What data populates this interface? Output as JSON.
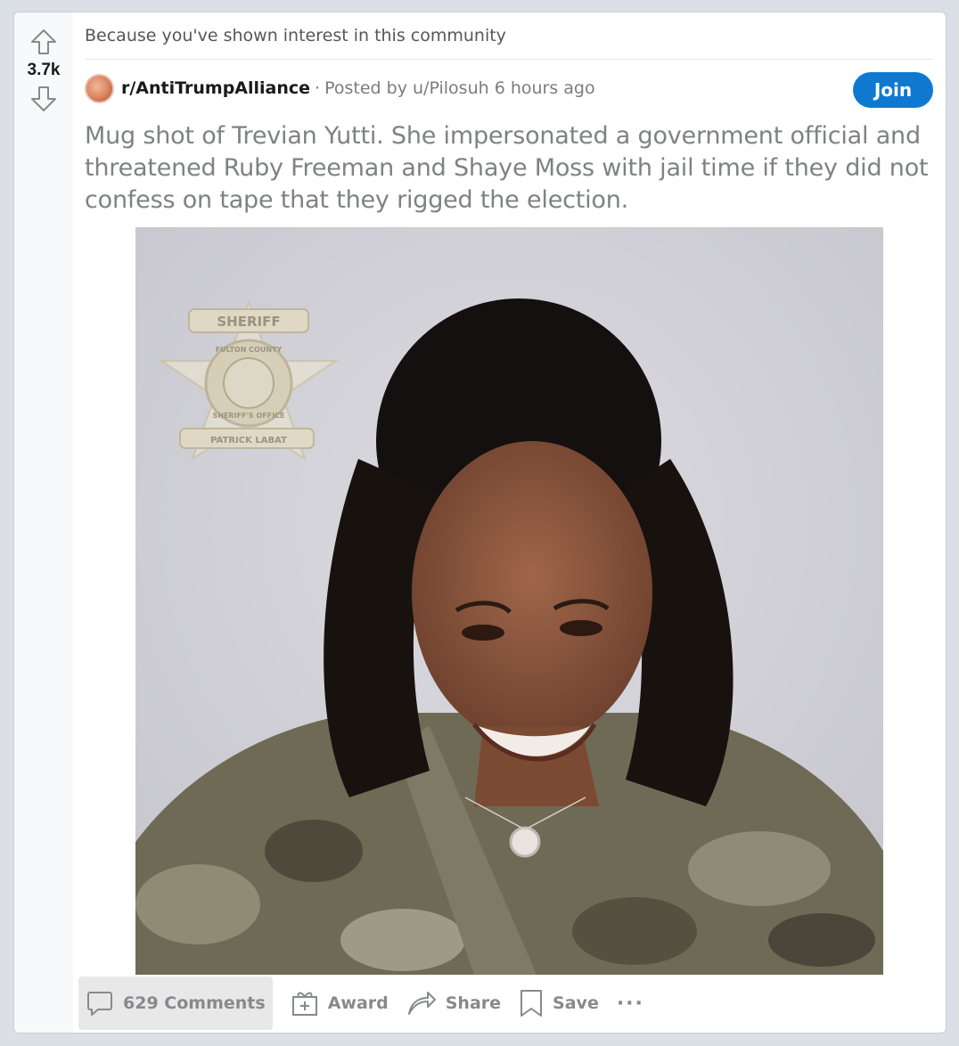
{
  "feed": {
    "recommend_reason": "Because you've shown interest in this community"
  },
  "vote": {
    "score": "3.7k",
    "upvote_icon": "arrow-up-icon",
    "downvote_icon": "arrow-down-icon"
  },
  "post": {
    "subreddit": "r/AntiTrumpAlliance",
    "separator": "·",
    "posted_prefix": "Posted by",
    "author": "u/Pilosuh",
    "time_ago": "6 hours ago",
    "join_label": "Join",
    "title": "Mug shot of Trevian Yutti. She impersonated a government official and threatened Ruby Freeman and Shaye Moss with jail time if they did not confess on tape that they rigged the election.",
    "image": {
      "seal_text_top": "SHERIFF",
      "seal_text_ring": "FULTON COUNTY",
      "seal_text_office": "SHERIFF'S OFFICE",
      "seal_text_name": "PATRICK LABAT"
    }
  },
  "actions": {
    "comments_label": "629 Comments",
    "award_label": "Award",
    "share_label": "Share",
    "save_label": "Save",
    "more_label": "···"
  },
  "colors": {
    "join_button": "#0f79d0",
    "title_text": "#7f8184",
    "page_background": "#dae0e6"
  }
}
